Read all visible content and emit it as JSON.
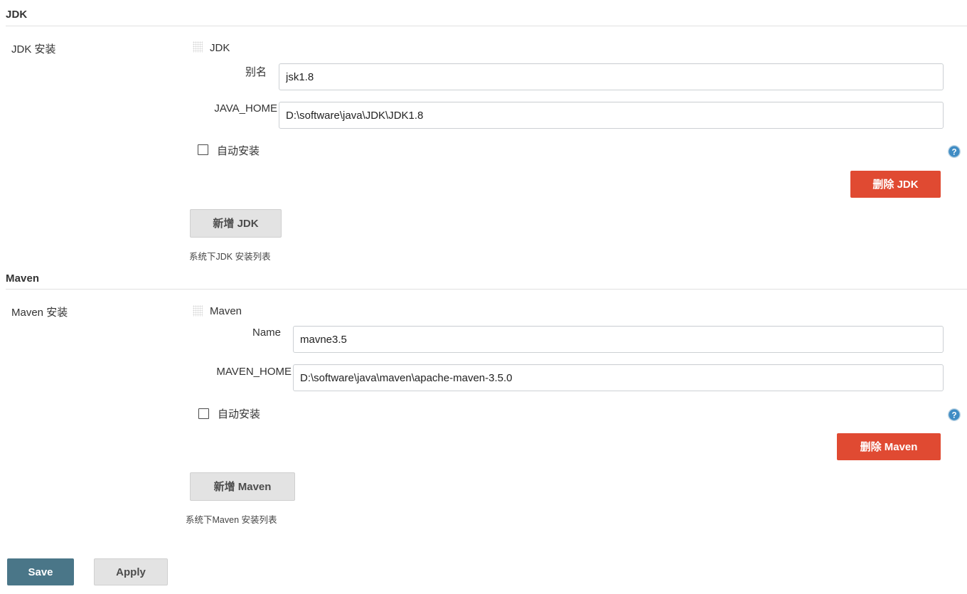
{
  "sections": [
    {
      "heading": "JDK",
      "row_label": "JDK 安装",
      "tool_name": "JDK",
      "drag_handle_icon": "drag-dots-icon",
      "fields": [
        {
          "label": "别名",
          "value": "jsk1.8"
        },
        {
          "label": "JAVA_HOME",
          "value": "D:\\software\\java\\JDK\\JDK1.8"
        }
      ],
      "checkbox": {
        "label": "自动安装",
        "checked": false
      },
      "help_icon": "help-circle-icon",
      "delete_button": "删除 JDK",
      "add_button": "新增 JDK",
      "hint": "系统下JDK 安装列表"
    },
    {
      "heading": "Maven",
      "row_label": "Maven 安装",
      "tool_name": "Maven",
      "drag_handle_icon": "drag-dots-icon",
      "fields": [
        {
          "label": "Name",
          "value": "mavne3.5"
        },
        {
          "label": "MAVEN_HOME",
          "value": "D:\\software\\java\\maven\\apache-maven-3.5.0"
        }
      ],
      "checkbox": {
        "label": "自动安装",
        "checked": false
      },
      "help_icon": "help-circle-icon",
      "delete_button": "删除 Maven",
      "add_button": "新增 Maven",
      "hint": "系统下Maven 安装列表"
    }
  ],
  "footer": {
    "save_label": "Save",
    "apply_label": "Apply"
  },
  "colors": {
    "danger": "#e04a32",
    "primary": "#4a7688",
    "button_grey": "#e3e3e3",
    "rule": "#e0e0e0",
    "help_blue": "#3f8cc4"
  }
}
